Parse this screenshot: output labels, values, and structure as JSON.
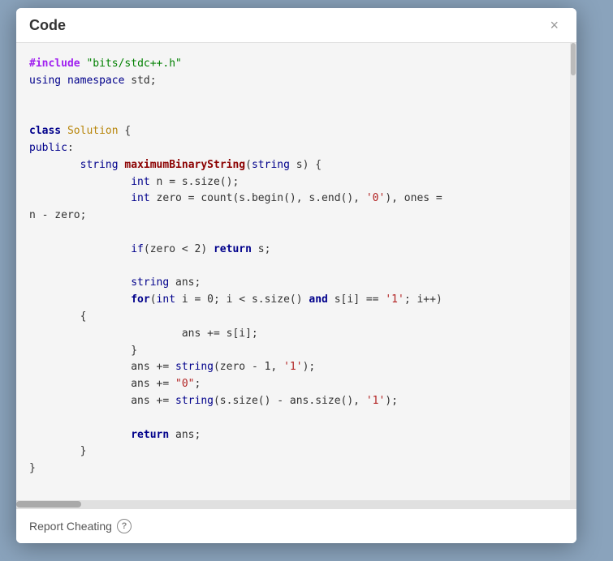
{
  "modal": {
    "title": "Code",
    "close_label": "×"
  },
  "code": {
    "include_directive": "#include",
    "include_file": "\"bits/stdc++.h\"",
    "using_namespace": "using namespace std;",
    "class_keyword": "class",
    "class_name": "Solution",
    "public_keyword": "public",
    "string_keyword": "string",
    "fn_name": "maximumBinaryString",
    "int_keyword": "int",
    "return_keyword": "return",
    "for_keyword": "for",
    "and_keyword": "and"
  },
  "footer": {
    "report_label": "Report Cheating",
    "help_icon": "?"
  }
}
